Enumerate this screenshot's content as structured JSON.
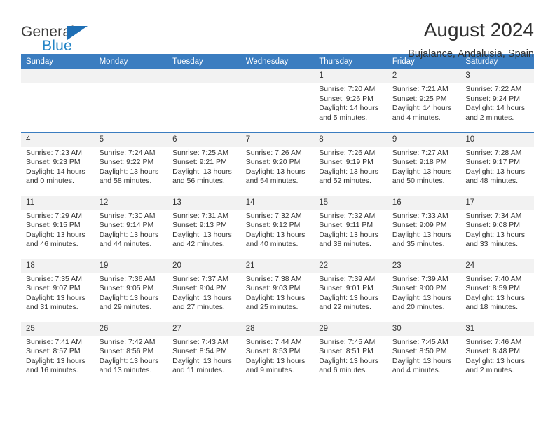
{
  "brand": {
    "name_top": "General",
    "name_bottom": "Blue",
    "triangle_color": "#1f6fb5",
    "blue_color": "#2384c6"
  },
  "header": {
    "title": "August 2024",
    "location": "Bujalance, Andalusia, Spain"
  },
  "theme": {
    "header_bg": "#3b7dc0",
    "daynum_bg": "#f2f2f2",
    "text": "#333333"
  },
  "weekdays": [
    "Sunday",
    "Monday",
    "Tuesday",
    "Wednesday",
    "Thursday",
    "Friday",
    "Saturday"
  ],
  "labels": {
    "sunrise": "Sunrise:",
    "sunset": "Sunset:",
    "daylight": "Daylight:"
  },
  "weeks": [
    [
      {
        "day": "",
        "sunrise": "",
        "sunset": "",
        "daylight_line1": "",
        "daylight_line2": ""
      },
      {
        "day": "",
        "sunrise": "",
        "sunset": "",
        "daylight_line1": "",
        "daylight_line2": ""
      },
      {
        "day": "",
        "sunrise": "",
        "sunset": "",
        "daylight_line1": "",
        "daylight_line2": ""
      },
      {
        "day": "",
        "sunrise": "",
        "sunset": "",
        "daylight_line1": "",
        "daylight_line2": ""
      },
      {
        "day": "1",
        "sunrise": "Sunrise: 7:20 AM",
        "sunset": "Sunset: 9:26 PM",
        "daylight_line1": "Daylight: 14 hours",
        "daylight_line2": "and 5 minutes."
      },
      {
        "day": "2",
        "sunrise": "Sunrise: 7:21 AM",
        "sunset": "Sunset: 9:25 PM",
        "daylight_line1": "Daylight: 14 hours",
        "daylight_line2": "and 4 minutes."
      },
      {
        "day": "3",
        "sunrise": "Sunrise: 7:22 AM",
        "sunset": "Sunset: 9:24 PM",
        "daylight_line1": "Daylight: 14 hours",
        "daylight_line2": "and 2 minutes."
      }
    ],
    [
      {
        "day": "4",
        "sunrise": "Sunrise: 7:23 AM",
        "sunset": "Sunset: 9:23 PM",
        "daylight_line1": "Daylight: 14 hours",
        "daylight_line2": "and 0 minutes."
      },
      {
        "day": "5",
        "sunrise": "Sunrise: 7:24 AM",
        "sunset": "Sunset: 9:22 PM",
        "daylight_line1": "Daylight: 13 hours",
        "daylight_line2": "and 58 minutes."
      },
      {
        "day": "6",
        "sunrise": "Sunrise: 7:25 AM",
        "sunset": "Sunset: 9:21 PM",
        "daylight_line1": "Daylight: 13 hours",
        "daylight_line2": "and 56 minutes."
      },
      {
        "day": "7",
        "sunrise": "Sunrise: 7:26 AM",
        "sunset": "Sunset: 9:20 PM",
        "daylight_line1": "Daylight: 13 hours",
        "daylight_line2": "and 54 minutes."
      },
      {
        "day": "8",
        "sunrise": "Sunrise: 7:26 AM",
        "sunset": "Sunset: 9:19 PM",
        "daylight_line1": "Daylight: 13 hours",
        "daylight_line2": "and 52 minutes."
      },
      {
        "day": "9",
        "sunrise": "Sunrise: 7:27 AM",
        "sunset": "Sunset: 9:18 PM",
        "daylight_line1": "Daylight: 13 hours",
        "daylight_line2": "and 50 minutes."
      },
      {
        "day": "10",
        "sunrise": "Sunrise: 7:28 AM",
        "sunset": "Sunset: 9:17 PM",
        "daylight_line1": "Daylight: 13 hours",
        "daylight_line2": "and 48 minutes."
      }
    ],
    [
      {
        "day": "11",
        "sunrise": "Sunrise: 7:29 AM",
        "sunset": "Sunset: 9:15 PM",
        "daylight_line1": "Daylight: 13 hours",
        "daylight_line2": "and 46 minutes."
      },
      {
        "day": "12",
        "sunrise": "Sunrise: 7:30 AM",
        "sunset": "Sunset: 9:14 PM",
        "daylight_line1": "Daylight: 13 hours",
        "daylight_line2": "and 44 minutes."
      },
      {
        "day": "13",
        "sunrise": "Sunrise: 7:31 AM",
        "sunset": "Sunset: 9:13 PM",
        "daylight_line1": "Daylight: 13 hours",
        "daylight_line2": "and 42 minutes."
      },
      {
        "day": "14",
        "sunrise": "Sunrise: 7:32 AM",
        "sunset": "Sunset: 9:12 PM",
        "daylight_line1": "Daylight: 13 hours",
        "daylight_line2": "and 40 minutes."
      },
      {
        "day": "15",
        "sunrise": "Sunrise: 7:32 AM",
        "sunset": "Sunset: 9:11 PM",
        "daylight_line1": "Daylight: 13 hours",
        "daylight_line2": "and 38 minutes."
      },
      {
        "day": "16",
        "sunrise": "Sunrise: 7:33 AM",
        "sunset": "Sunset: 9:09 PM",
        "daylight_line1": "Daylight: 13 hours",
        "daylight_line2": "and 35 minutes."
      },
      {
        "day": "17",
        "sunrise": "Sunrise: 7:34 AM",
        "sunset": "Sunset: 9:08 PM",
        "daylight_line1": "Daylight: 13 hours",
        "daylight_line2": "and 33 minutes."
      }
    ],
    [
      {
        "day": "18",
        "sunrise": "Sunrise: 7:35 AM",
        "sunset": "Sunset: 9:07 PM",
        "daylight_line1": "Daylight: 13 hours",
        "daylight_line2": "and 31 minutes."
      },
      {
        "day": "19",
        "sunrise": "Sunrise: 7:36 AM",
        "sunset": "Sunset: 9:05 PM",
        "daylight_line1": "Daylight: 13 hours",
        "daylight_line2": "and 29 minutes."
      },
      {
        "day": "20",
        "sunrise": "Sunrise: 7:37 AM",
        "sunset": "Sunset: 9:04 PM",
        "daylight_line1": "Daylight: 13 hours",
        "daylight_line2": "and 27 minutes."
      },
      {
        "day": "21",
        "sunrise": "Sunrise: 7:38 AM",
        "sunset": "Sunset: 9:03 PM",
        "daylight_line1": "Daylight: 13 hours",
        "daylight_line2": "and 25 minutes."
      },
      {
        "day": "22",
        "sunrise": "Sunrise: 7:39 AM",
        "sunset": "Sunset: 9:01 PM",
        "daylight_line1": "Daylight: 13 hours",
        "daylight_line2": "and 22 minutes."
      },
      {
        "day": "23",
        "sunrise": "Sunrise: 7:39 AM",
        "sunset": "Sunset: 9:00 PM",
        "daylight_line1": "Daylight: 13 hours",
        "daylight_line2": "and 20 minutes."
      },
      {
        "day": "24",
        "sunrise": "Sunrise: 7:40 AM",
        "sunset": "Sunset: 8:59 PM",
        "daylight_line1": "Daylight: 13 hours",
        "daylight_line2": "and 18 minutes."
      }
    ],
    [
      {
        "day": "25",
        "sunrise": "Sunrise: 7:41 AM",
        "sunset": "Sunset: 8:57 PM",
        "daylight_line1": "Daylight: 13 hours",
        "daylight_line2": "and 16 minutes."
      },
      {
        "day": "26",
        "sunrise": "Sunrise: 7:42 AM",
        "sunset": "Sunset: 8:56 PM",
        "daylight_line1": "Daylight: 13 hours",
        "daylight_line2": "and 13 minutes."
      },
      {
        "day": "27",
        "sunrise": "Sunrise: 7:43 AM",
        "sunset": "Sunset: 8:54 PM",
        "daylight_line1": "Daylight: 13 hours",
        "daylight_line2": "and 11 minutes."
      },
      {
        "day": "28",
        "sunrise": "Sunrise: 7:44 AM",
        "sunset": "Sunset: 8:53 PM",
        "daylight_line1": "Daylight: 13 hours",
        "daylight_line2": "and 9 minutes."
      },
      {
        "day": "29",
        "sunrise": "Sunrise: 7:45 AM",
        "sunset": "Sunset: 8:51 PM",
        "daylight_line1": "Daylight: 13 hours",
        "daylight_line2": "and 6 minutes."
      },
      {
        "day": "30",
        "sunrise": "Sunrise: 7:45 AM",
        "sunset": "Sunset: 8:50 PM",
        "daylight_line1": "Daylight: 13 hours",
        "daylight_line2": "and 4 minutes."
      },
      {
        "day": "31",
        "sunrise": "Sunrise: 7:46 AM",
        "sunset": "Sunset: 8:48 PM",
        "daylight_line1": "Daylight: 13 hours",
        "daylight_line2": "and 2 minutes."
      }
    ]
  ]
}
